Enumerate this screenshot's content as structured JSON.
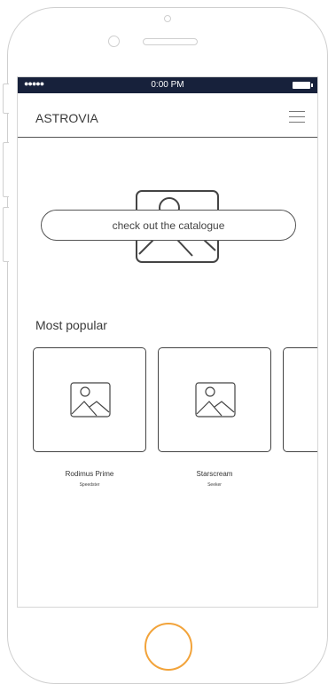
{
  "status_bar": {
    "signal": "●●●●●",
    "time": "0:00 PM"
  },
  "header": {
    "title": "ASTROVIA"
  },
  "hero": {
    "cta_label": "check out the catalogue"
  },
  "popular": {
    "title": "Most popular",
    "items": [
      {
        "name": "Rodimus Prime",
        "subtitle": "Speedster"
      },
      {
        "name": "Starscream",
        "subtitle": "Seeker"
      }
    ]
  },
  "colors": {
    "status_bar_bg": "#17213b",
    "home_button_ring": "#f2a33a",
    "outline": "#444444"
  }
}
